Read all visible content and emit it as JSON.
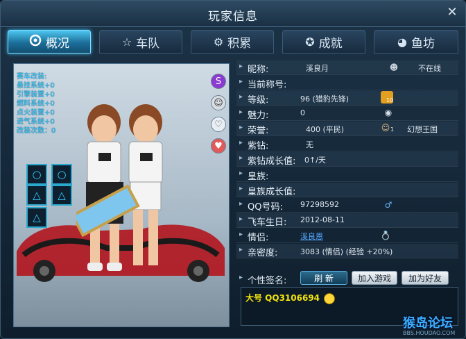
{
  "window": {
    "title": "玩家信息",
    "close_symbol": "✕"
  },
  "tabs": [
    {
      "label": "概况",
      "icon": "swirl-icon"
    },
    {
      "label": "车队",
      "icon": "star-icon"
    },
    {
      "label": "积累",
      "icon": "gear-icon"
    },
    {
      "label": "成就",
      "icon": "medal-icon"
    },
    {
      "label": "鱼坊",
      "icon": "fish-icon"
    }
  ],
  "left_panel": {
    "stats": [
      "赛车改装:",
      "悬挂系统+0",
      "引擎装置+0",
      "燃料系统+0",
      "点火装置+0",
      "进气系统+0",
      "改装次数：0"
    ],
    "slot_symbols": [
      "○",
      "○",
      "△",
      "△",
      "△"
    ]
  },
  "info": {
    "nickname_label": "昵称:",
    "nickname_value": "溪良月",
    "online_status": "不在线",
    "title_label": "当前称号:",
    "level_label": "等级:",
    "level_value": "96 (猎豹先锋)",
    "level_badge": "10",
    "charm_label": "魅力:",
    "charm_value": "0",
    "honor_label": "荣誉:",
    "honor_value": "400 (平民)",
    "honor_badge": "1",
    "kingdom_value": "幻想王国",
    "purple_label": "紫钻:",
    "purple_value": "无",
    "purple_growth_label": "紫钻成长值:",
    "purple_growth_value": "0↑/天",
    "royal_label": "皇族:",
    "royal_growth_label": "皇族成长值:",
    "qq_label": "QQ号码:",
    "qq_value": "97298592",
    "birthday_label": "飞车生日:",
    "birthday_value": "2012-08-11",
    "partner_label": "情侣:",
    "partner_value": "溪良恩",
    "intimacy_label": "亲密度:",
    "intimacy_value": "3083 (情侣) (经验 +20%)"
  },
  "signature": {
    "label": "个性签名:",
    "refresh_button": "刷 新",
    "join_game_button": "加入游戏",
    "add_friend_button": "加为好友",
    "text": "大号 QQ3106694"
  },
  "watermark": {
    "main": "猴岛论坛",
    "sub": "BBS.HOUDAO.COM"
  },
  "colors": {
    "accent": "#2ad3ff",
    "gold": "#f3e30b",
    "link": "#55a8ff"
  }
}
